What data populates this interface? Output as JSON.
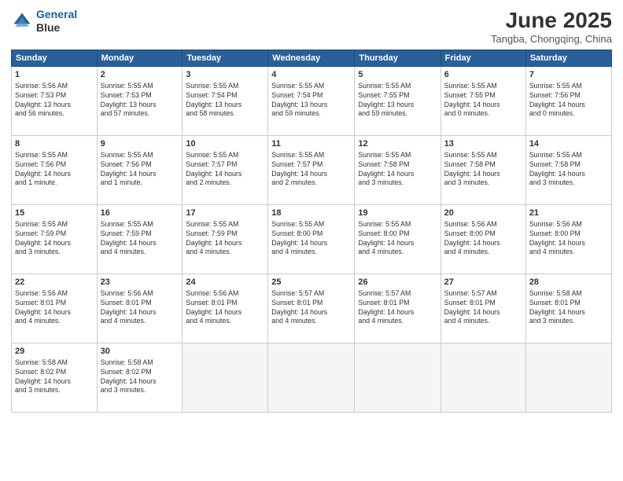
{
  "header": {
    "logo_line1": "General",
    "logo_line2": "Blue",
    "month_year": "June 2025",
    "location": "Tangba, Chongqing, China"
  },
  "days_of_week": [
    "Sunday",
    "Monday",
    "Tuesday",
    "Wednesday",
    "Thursday",
    "Friday",
    "Saturday"
  ],
  "weeks": [
    [
      {
        "num": "1",
        "sunrise": "5:56 AM",
        "sunset": "7:53 PM",
        "daylight": "13 hours and 56 minutes."
      },
      {
        "num": "2",
        "sunrise": "5:55 AM",
        "sunset": "7:53 PM",
        "daylight": "13 hours and 57 minutes."
      },
      {
        "num": "3",
        "sunrise": "5:55 AM",
        "sunset": "7:54 PM",
        "daylight": "13 hours and 58 minutes."
      },
      {
        "num": "4",
        "sunrise": "5:55 AM",
        "sunset": "7:54 PM",
        "daylight": "13 hours and 59 minutes."
      },
      {
        "num": "5",
        "sunrise": "5:55 AM",
        "sunset": "7:55 PM",
        "daylight": "13 hours and 59 minutes."
      },
      {
        "num": "6",
        "sunrise": "5:55 AM",
        "sunset": "7:55 PM",
        "daylight": "14 hours and 0 minutes."
      },
      {
        "num": "7",
        "sunrise": "5:55 AM",
        "sunset": "7:56 PM",
        "daylight": "14 hours and 0 minutes."
      }
    ],
    [
      {
        "num": "8",
        "sunrise": "5:55 AM",
        "sunset": "7:56 PM",
        "daylight": "14 hours and 1 minute."
      },
      {
        "num": "9",
        "sunrise": "5:55 AM",
        "sunset": "7:56 PM",
        "daylight": "14 hours and 1 minute."
      },
      {
        "num": "10",
        "sunrise": "5:55 AM",
        "sunset": "7:57 PM",
        "daylight": "14 hours and 2 minutes."
      },
      {
        "num": "11",
        "sunrise": "5:55 AM",
        "sunset": "7:57 PM",
        "daylight": "14 hours and 2 minutes."
      },
      {
        "num": "12",
        "sunrise": "5:55 AM",
        "sunset": "7:58 PM",
        "daylight": "14 hours and 3 minutes."
      },
      {
        "num": "13",
        "sunrise": "5:55 AM",
        "sunset": "7:58 PM",
        "daylight": "14 hours and 3 minutes."
      },
      {
        "num": "14",
        "sunrise": "5:55 AM",
        "sunset": "7:58 PM",
        "daylight": "14 hours and 3 minutes."
      }
    ],
    [
      {
        "num": "15",
        "sunrise": "5:55 AM",
        "sunset": "7:59 PM",
        "daylight": "14 hours and 3 minutes."
      },
      {
        "num": "16",
        "sunrise": "5:55 AM",
        "sunset": "7:59 PM",
        "daylight": "14 hours and 4 minutes."
      },
      {
        "num": "17",
        "sunrise": "5:55 AM",
        "sunset": "7:59 PM",
        "daylight": "14 hours and 4 minutes."
      },
      {
        "num": "18",
        "sunrise": "5:55 AM",
        "sunset": "8:00 PM",
        "daylight": "14 hours and 4 minutes."
      },
      {
        "num": "19",
        "sunrise": "5:55 AM",
        "sunset": "8:00 PM",
        "daylight": "14 hours and 4 minutes."
      },
      {
        "num": "20",
        "sunrise": "5:56 AM",
        "sunset": "8:00 PM",
        "daylight": "14 hours and 4 minutes."
      },
      {
        "num": "21",
        "sunrise": "5:56 AM",
        "sunset": "8:00 PM",
        "daylight": "14 hours and 4 minutes."
      }
    ],
    [
      {
        "num": "22",
        "sunrise": "5:56 AM",
        "sunset": "8:01 PM",
        "daylight": "14 hours and 4 minutes."
      },
      {
        "num": "23",
        "sunrise": "5:56 AM",
        "sunset": "8:01 PM",
        "daylight": "14 hours and 4 minutes."
      },
      {
        "num": "24",
        "sunrise": "5:56 AM",
        "sunset": "8:01 PM",
        "daylight": "14 hours and 4 minutes."
      },
      {
        "num": "25",
        "sunrise": "5:57 AM",
        "sunset": "8:01 PM",
        "daylight": "14 hours and 4 minutes."
      },
      {
        "num": "26",
        "sunrise": "5:57 AM",
        "sunset": "8:01 PM",
        "daylight": "14 hours and 4 minutes."
      },
      {
        "num": "27",
        "sunrise": "5:57 AM",
        "sunset": "8:01 PM",
        "daylight": "14 hours and 4 minutes."
      },
      {
        "num": "28",
        "sunrise": "5:58 AM",
        "sunset": "8:01 PM",
        "daylight": "14 hours and 3 minutes."
      }
    ],
    [
      {
        "num": "29",
        "sunrise": "5:58 AM",
        "sunset": "8:02 PM",
        "daylight": "14 hours and 3 minutes."
      },
      {
        "num": "30",
        "sunrise": "5:58 AM",
        "sunset": "8:02 PM",
        "daylight": "14 hours and 3 minutes."
      },
      null,
      null,
      null,
      null,
      null
    ]
  ]
}
